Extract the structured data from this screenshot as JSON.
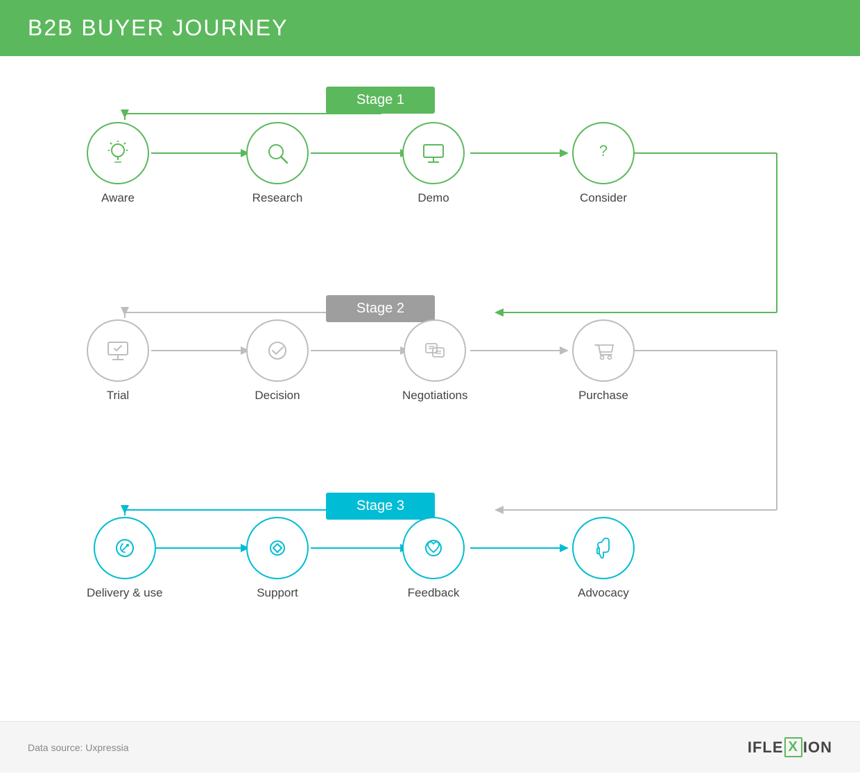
{
  "header": {
    "title": "B2B BUYER JOURNEY"
  },
  "stages": [
    {
      "id": "stage1",
      "label": "Stage 1",
      "color": "green"
    },
    {
      "id": "stage2",
      "label": "Stage 2",
      "color": "gray"
    },
    {
      "id": "stage3",
      "label": "Stage 3",
      "color": "blue"
    }
  ],
  "row1": {
    "nodes": [
      {
        "id": "aware",
        "label": "Aware",
        "color": "green"
      },
      {
        "id": "research",
        "label": "Research",
        "color": "green"
      },
      {
        "id": "demo",
        "label": "Demo",
        "color": "green"
      },
      {
        "id": "consider",
        "label": "Consider",
        "color": "green"
      }
    ]
  },
  "row2": {
    "nodes": [
      {
        "id": "trial",
        "label": "Trial",
        "color": "gray"
      },
      {
        "id": "decision",
        "label": "Decision",
        "color": "gray"
      },
      {
        "id": "negotiations",
        "label": "Negotiations",
        "color": "gray"
      },
      {
        "id": "purchase",
        "label": "Purchase",
        "color": "gray"
      }
    ]
  },
  "row3": {
    "nodes": [
      {
        "id": "delivery",
        "label": "Delivery & use",
        "color": "blue"
      },
      {
        "id": "support",
        "label": "Support",
        "color": "blue"
      },
      {
        "id": "feedback",
        "label": "Feedback",
        "color": "blue"
      },
      {
        "id": "advocacy",
        "label": "Advocacy",
        "color": "blue"
      }
    ]
  },
  "footer": {
    "source": "Data source: Uxpressia",
    "logo": {
      "prefix": "IFLE",
      "x": "X",
      "suffix": "ION"
    }
  }
}
